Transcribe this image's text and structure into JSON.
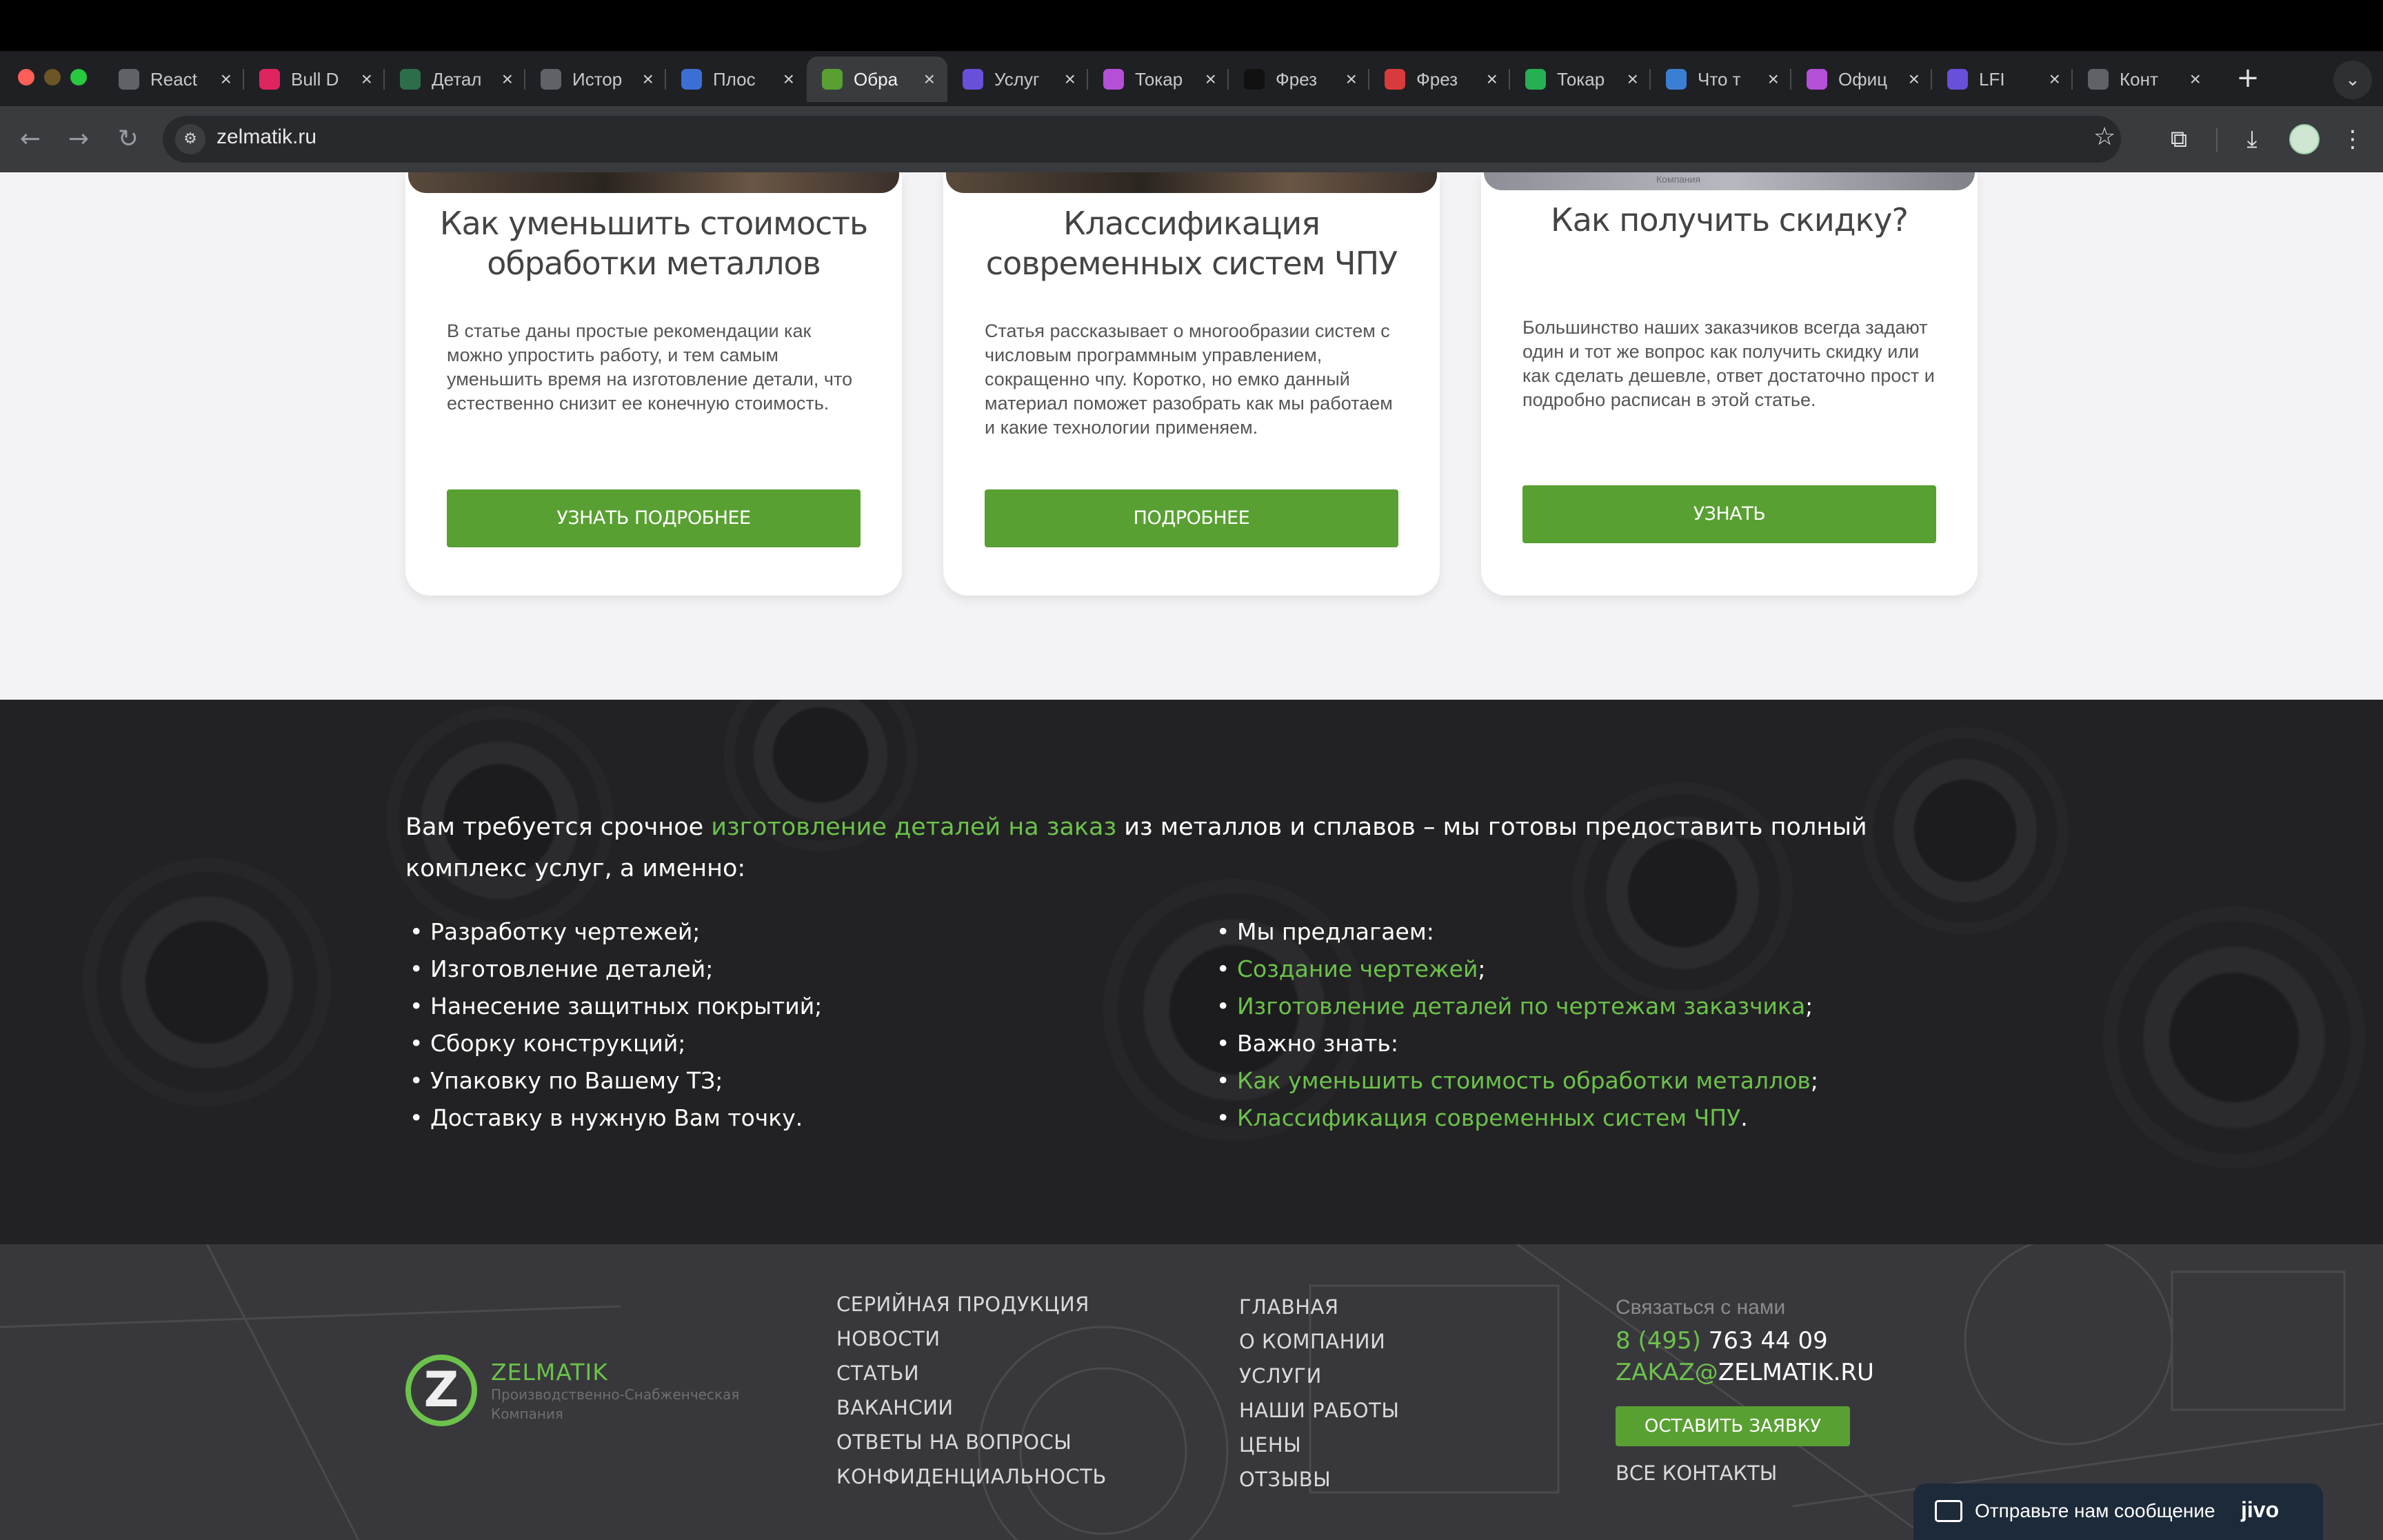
{
  "browser": {
    "tabs": [
      {
        "label": "React",
        "icon": "globe-icon",
        "color": "#5f6368"
      },
      {
        "label": "Bull D",
        "icon": "target-icon",
        "color": "#e0245e"
      },
      {
        "label": "Детал",
        "icon": "runner-icon",
        "color": "#2c6e49"
      },
      {
        "label": "Истор",
        "icon": "history-icon",
        "color": "#5f6368"
      },
      {
        "label": "Плос",
        "icon": "arrow-logo-icon",
        "color": "#3b6fd4"
      },
      {
        "label": "Обра",
        "icon": "zelmatik-icon",
        "color": "#59a032"
      },
      {
        "label": "Услуг",
        "icon": "cube-icon",
        "color": "#6a4fd8"
      },
      {
        "label": "Токар",
        "icon": "grid-logo-icon",
        "color": "#b44fd8"
      },
      {
        "label": "Фрез",
        "icon": "cnc-icon",
        "color": "#111111"
      },
      {
        "label": "Фрез",
        "icon": "swirl-icon",
        "color": "#d83b3b"
      },
      {
        "label": "Токар",
        "icon": "green-square-icon",
        "color": "#27b052"
      },
      {
        "label": "Что т",
        "icon": "image-icon",
        "color": "#3b7fd4"
      },
      {
        "label": "Офиц",
        "icon": "grid-logo-icon",
        "color": "#b44fd8"
      },
      {
        "label": "LFI",
        "icon": "cube-icon",
        "color": "#6a4fd8"
      },
      {
        "label": "Конт",
        "icon": "globe-icon",
        "color": "#5f6368"
      }
    ],
    "url": "zelmatik.ru"
  },
  "cards": [
    {
      "title": "Как уменьшить стоимость обработки металлов",
      "text": "В статье даны простые рекомендации как можно упростить работу, и тем самым уменьшить время на изготовление детали, что естественно снизит ее конечную стоимость.",
      "button": "УЗНАТЬ ПОДРОБНЕЕ"
    },
    {
      "title": "Классификация современных систем ЧПУ",
      "text": "Статья рассказывает о многообразии систем с числовым программным управлением, сокращенно чпу. Коротко, но емко данный материал поможет разобрать как мы работаем и какие технологии применяем.",
      "button": "ПОДРОБНЕЕ"
    },
    {
      "title": "Как получить скидку?",
      "image_caption": "Компания",
      "text": "Большинство наших заказчиков всегда задают один и тот же вопрос как получить скидку или как сделать дешевле, ответ достаточно прост и подробно расписан в этой статье.",
      "button": "УЗНАТЬ"
    }
  ],
  "services": {
    "intro_before": "Вам требуется срочное ",
    "intro_link": "изготовление деталей на заказ",
    "intro_after": " из металлов и сплавов – мы готовы предоставить полный комплекс услуг, а именно:",
    "left_list": [
      "Разработку чертежей;",
      "Изготовление деталей;",
      "Нанесение защитных покрытий;",
      "Сборку конструкций;",
      "Упаковку по Вашему ТЗ;",
      "Доставку в нужную Вам точку."
    ],
    "right_list": [
      {
        "text": "Мы предлагаем:",
        "link": false,
        "suffix": ""
      },
      {
        "text": "Создание чертежей",
        "link": true,
        "suffix": ";"
      },
      {
        "text": "Изготовление деталей по чертежам заказчика",
        "link": true,
        "suffix": ";"
      },
      {
        "text": "Важно знать:",
        "link": false,
        "suffix": ""
      },
      {
        "text": "Как уменьшить стоимость обработки металлов",
        "link": true,
        "suffix": ";"
      },
      {
        "text": "Классификация современных систем ЧПУ",
        "link": true,
        "suffix": "."
      }
    ]
  },
  "footer": {
    "logo_name": "ZELMATIK",
    "logo_sub": "Производственно-Снабженческая Компания",
    "col1": [
      "СЕРИЙНАЯ ПРОДУКЦИЯ",
      "НОВОСТИ",
      "СТАТЬИ",
      "ВАКАНСИИ",
      "ОТВЕТЫ НА ВОПРОСЫ",
      "КОНФИДЕНЦИАЛЬНОСТЬ"
    ],
    "col2": [
      "ГЛАВНАЯ",
      "О КОМПАНИИ",
      "УСЛУГИ",
      "НАШИ РАБОТЫ",
      "ЦЕНЫ",
      "ОТЗЫВЫ"
    ],
    "contact_heading": "Связаться с нами",
    "phone_code": "8 (495)",
    "phone_number": " 763 44 09",
    "email_user": "ZAKAZ@",
    "email_domain": "ZELMATIK.RU",
    "order_button": "ОСТАВИТЬ ЗАЯВКУ",
    "all_contacts": "ВСЕ КОНТАКТЫ"
  },
  "chat_widget": {
    "text": "Отправьте нам сообщение",
    "brand": "jivo"
  },
  "colors": {
    "accent_green": "#59a032",
    "link_green": "#6cc24a",
    "footer_bg": "#38383c"
  }
}
